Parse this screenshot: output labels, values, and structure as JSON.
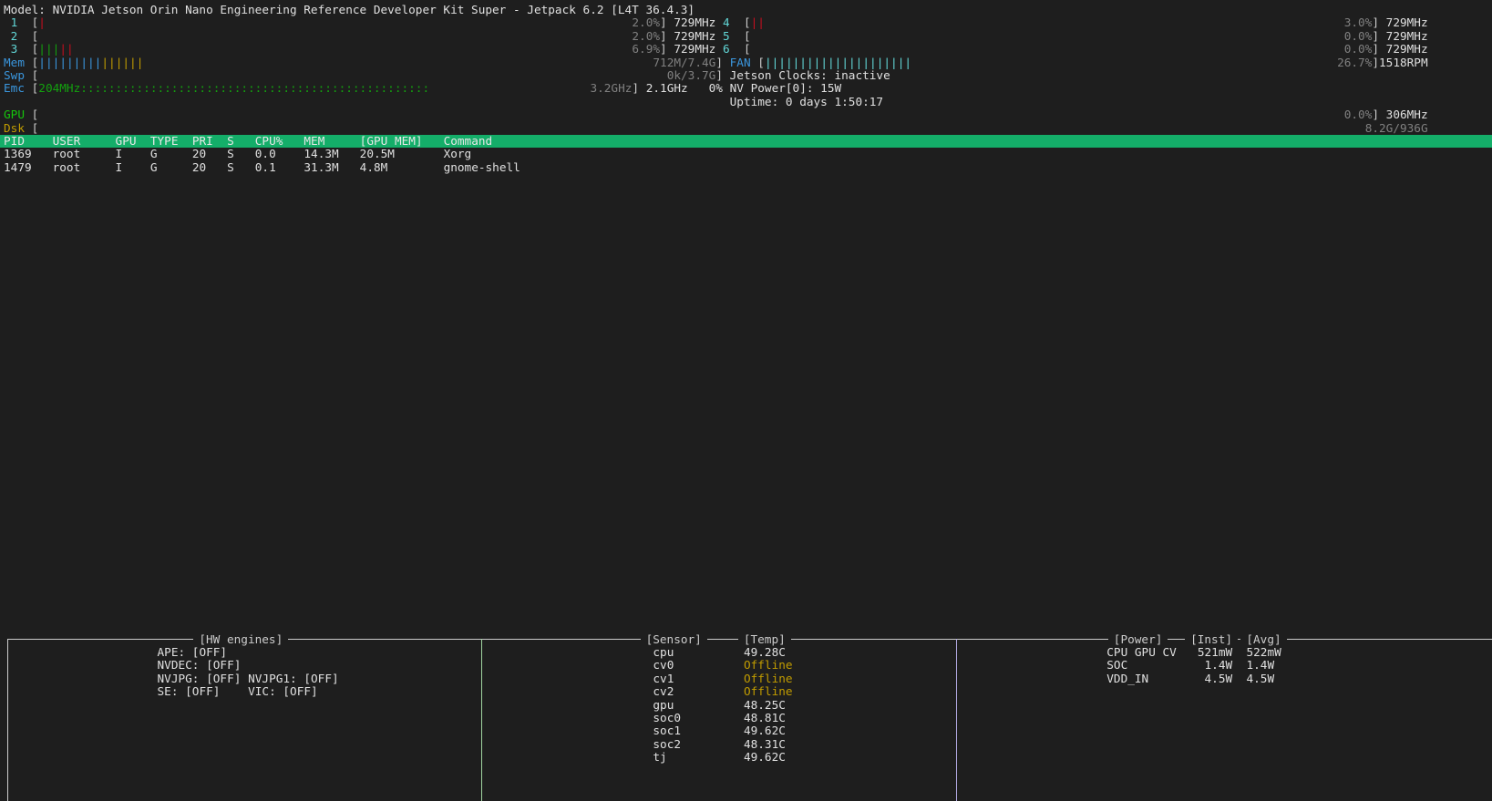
{
  "header": {
    "model": "Model: NVIDIA Jetson Orin Nano Engineering Reference Developer Kit Super - Jetpack 6.2 [L4T 36.4.3]"
  },
  "bar_colors": {
    "r": "#c50f1f",
    "g": "#13a10e",
    "b": "#3a96dd",
    "c": "#61d6d6",
    "y": "#c19c00"
  },
  "cpus": [
    {
      "id": "1",
      "pct": "2.0%",
      "freq": "729MHz",
      "bars": "r"
    },
    {
      "id": "2",
      "pct": "2.0%",
      "freq": "729MHz",
      "bars": ""
    },
    {
      "id": "3",
      "pct": "6.9%",
      "freq": "729MHz",
      "bars": "gggrr"
    },
    {
      "id": "4",
      "pct": "3.0%",
      "freq": "729MHz",
      "bars": "rr"
    },
    {
      "id": "5",
      "pct": "0.0%",
      "freq": "729MHz",
      "bars": ""
    },
    {
      "id": "6",
      "pct": "0.0%",
      "freq": "729MHz",
      "bars": ""
    }
  ],
  "mem": {
    "label": "Mem",
    "value": "712M/7.4G",
    "bars": "bbbbbbbbbyyyyyy"
  },
  "swap": {
    "label": "Swp",
    "value": "0k/3.7G"
  },
  "emc": {
    "label": "Emc",
    "freq": "204MHz",
    "fill": "::::::::::::::::::::::::::::::::::::::::::::::::::",
    "max": "3.2GHz",
    "cur": "2.1GHz",
    "util": "0%"
  },
  "fan": {
    "label": "FAN",
    "pct": "26.7%",
    "rpm": "1518RPM",
    "bars": "ccccccccccccccccccccc"
  },
  "jetson_clocks": "Jetson Clocks: inactive",
  "nv_power": "NV Power[0]: 15W",
  "uptime": "Uptime: 0 days 1:50:17",
  "gpu": {
    "label": "GPU",
    "pct": "0.0%",
    "freq": "306MHz"
  },
  "disk": {
    "label": "Dsk",
    "value": "8.2G/936G"
  },
  "processes": {
    "columns": [
      "PID",
      "USER",
      "GPU",
      "TYPE",
      "PRI",
      "S",
      "CPU%",
      "MEM",
      "[GPU MEM]",
      "Command"
    ],
    "rows": [
      [
        "1369",
        "root",
        "I",
        "G",
        "20",
        "S",
        "0.0",
        "14.3M",
        "20.5M",
        "Xorg"
      ],
      [
        "1479",
        "root",
        "I",
        "G",
        "20",
        "S",
        "0.1",
        "31.3M",
        "4.8M",
        "gnome-shell"
      ]
    ]
  },
  "hw_engines": {
    "title": "[HW engines]",
    "ape": "APE: [OFF]",
    "nvdec": "NVDEC: [OFF]",
    "nvjpg": "NVJPG: [OFF]",
    "nvjpg1": "NVJPG1: [OFF]",
    "se": "SE: [OFF]",
    "vic": "VIC: [OFF]"
  },
  "sensors": {
    "title_sensor": "[Sensor]",
    "title_temp": "[Temp]",
    "rows": [
      {
        "name": "cpu",
        "temp": "49.28C"
      },
      {
        "name": "cv0",
        "temp": "Offline"
      },
      {
        "name": "cv1",
        "temp": "Offline"
      },
      {
        "name": "cv2",
        "temp": "Offline"
      },
      {
        "name": "gpu",
        "temp": "48.25C"
      },
      {
        "name": "soc0",
        "temp": "48.81C"
      },
      {
        "name": "soc1",
        "temp": "49.62C"
      },
      {
        "name": "soc2",
        "temp": "48.31C"
      },
      {
        "name": "tj",
        "temp": "49.62C"
      }
    ]
  },
  "power": {
    "title_power": "[Power]",
    "title_inst": "[Inst]",
    "title_avg": "[Avg]",
    "rows": [
      {
        "name": "CPU GPU CV",
        "inst": "521mW",
        "avg": "522mW"
      },
      {
        "name": "SOC",
        "inst": "1.4W",
        "avg": "1.4W"
      },
      {
        "name": "VDD_IN",
        "inst": "4.5W",
        "avg": "4.5W"
      }
    ]
  }
}
